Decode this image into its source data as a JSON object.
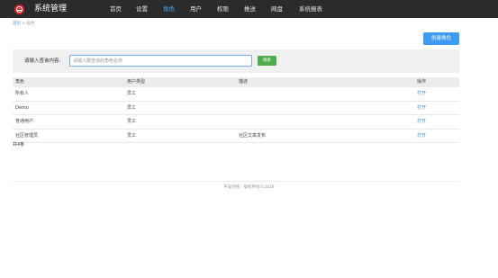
{
  "header": {
    "logo_icon": "brand-logo-icon",
    "title": "系统管理",
    "nav": [
      {
        "label": "首页",
        "active": false
      },
      {
        "label": "设置",
        "active": false
      },
      {
        "label": "角色",
        "active": true
      },
      {
        "label": "用户",
        "active": false
      },
      {
        "label": "权限",
        "active": false
      },
      {
        "label": "推送",
        "active": false
      },
      {
        "label": "网盘",
        "active": false
      },
      {
        "label": "系统报表",
        "active": false
      }
    ]
  },
  "breadcrumb": {
    "home": "首页",
    "separator": ">",
    "current": "角色"
  },
  "toolbar": {
    "create_label": "创建角色"
  },
  "search": {
    "label": "请输入查询内容:",
    "value": "",
    "placeholder": "请输入要查询的角色名称",
    "button_label": "搜索"
  },
  "table": {
    "headers": [
      "角色",
      "用户类型",
      "描述",
      "操作"
    ],
    "rows": [
      {
        "name": "所有人",
        "type": "员工",
        "desc": "",
        "action": "打开"
      },
      {
        "name": "Demo",
        "type": "员工",
        "desc": "",
        "action": "打开"
      },
      {
        "name": "普通用户",
        "type": "员工",
        "desc": "",
        "action": "打开"
      },
      {
        "name": "社区管理员",
        "type": "员工",
        "desc": "社区文章发布",
        "action": "打开"
      }
    ]
  },
  "summary": {
    "total": "共4条"
  },
  "footer": {
    "text": "平安地铁 · 版权所有©2018"
  },
  "colors": {
    "topbar": "#2b2b2b",
    "accent": "#3d9bf2",
    "nav_active": "#4aa3f0",
    "search_button": "#4fae4e",
    "logo": "#d9262c"
  }
}
